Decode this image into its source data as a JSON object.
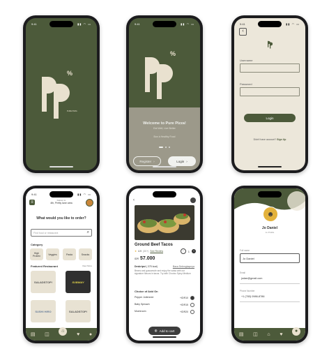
{
  "status": {
    "time": "9:41",
    "icons": "▮▮ ◠ ▭"
  },
  "splash": {
    "logo_letters": "PP",
    "logo_tag": "PURE PIZZA"
  },
  "welcome": {
    "title": "Welcome to Pure Pizza!",
    "subtitle": "Eat Well, Live Better",
    "tagline": "Bon à Healthy Food",
    "register_label": "Register",
    "login_label": "Login"
  },
  "login": {
    "username_label": "Username",
    "password_label": "Password",
    "login_button": "Login",
    "no_account": "Didn't have account?",
    "signup_link": "Sign Up"
  },
  "home": {
    "deliver_to": "Deliver to",
    "address": "4th, Pretty lane area",
    "question": "What would you like to order?",
    "search_placeholder": "Find food or restaurant",
    "category_title": "Category",
    "categories": [
      "High Protein",
      "Veggies",
      "Pasta",
      "Snacks"
    ],
    "featured_title": "Featured Restaurant",
    "view_more": "View More",
    "restaurants": [
      "SALADSTOP!",
      "SUBWAY",
      "SUSHI HIRO",
      "SALADSTOP!"
    ]
  },
  "detail": {
    "title": "Ground Beef Tacos",
    "rating": "4.9",
    "reviews": "(30+)",
    "see_review": "See Review",
    "qty": "1",
    "currency": "IDR",
    "price": "57.000",
    "description_title": "Deskripsi",
    "description_sub": "( 375 kcal)",
    "read_more": "Baca Selengkapnya",
    "description": "Beans and guacamole and enjoy the salsa with our signature flavors in tacos. Try with Chorizo Spicy Medium",
    "addon_title": "Choice of Add On",
    "addons": [
      {
        "name": "Pepper Julienned",
        "price": "+IDR10"
      },
      {
        "name": "Baby Spinach",
        "price": "+IDR15"
      },
      {
        "name": "Mushroom",
        "price": "+IDR20"
      }
    ],
    "add_to_cart": "Add to cart"
  },
  "profile": {
    "name": "Jo Daniel",
    "handle": "Jo Profile",
    "full_name_label": "Full name",
    "full_name_value": "Jo Daniel",
    "email_label": "Email",
    "email_value": "jodan@gmail.com",
    "phone_label": "Phone Number",
    "phone_value": "+1 (783) 0986-8786"
  }
}
